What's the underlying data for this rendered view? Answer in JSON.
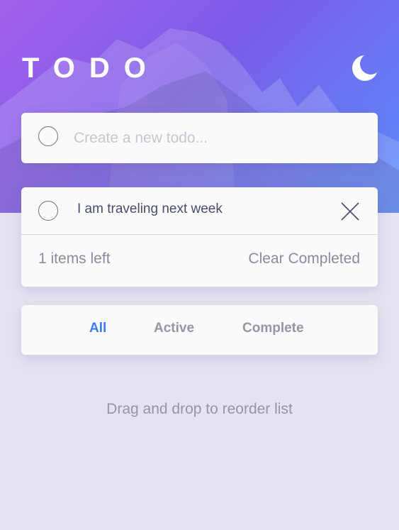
{
  "app": {
    "title": "TODO",
    "theme_icon": "moon-icon"
  },
  "new_todo": {
    "placeholder": "Create a new todo...",
    "value": ""
  },
  "todos": [
    {
      "text": "I am traveling next week",
      "completed": false
    }
  ],
  "footer": {
    "items_left": "1 items left",
    "clear_label": "Clear Completed"
  },
  "filters": {
    "all": "All",
    "active": "Active",
    "complete": "Complete",
    "selected": "All"
  },
  "hint": "Drag and drop to reorder list",
  "colors": {
    "accent": "#3a7bfd",
    "background": "#e4e4f1",
    "card": "#fafafa",
    "text": "#494c6b",
    "muted": "#9495a5",
    "gradient_start": "#a461ec",
    "gradient_end": "#5a8ffb"
  }
}
